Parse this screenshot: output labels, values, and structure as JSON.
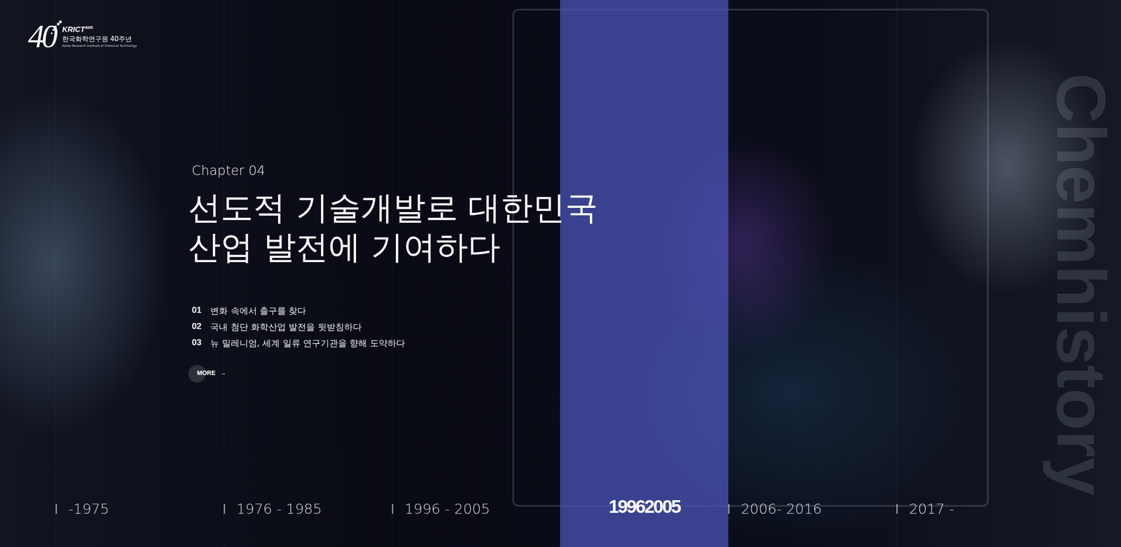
{
  "logo": {
    "mark": "40",
    "name": "KRICT",
    "superscript": "40th",
    "title": "한국화학연구원 40주년",
    "subtitle": "Korea Research Institute of Chemical Technology"
  },
  "chapter": {
    "label": "Chapter 04",
    "title_lines": [
      "선도적 기술개발로 대한민국",
      "산업 발전에 기여하다"
    ],
    "items": [
      {
        "number": "01",
        "text": "변화 속에서 출구를 찾다"
      },
      {
        "number": "02",
        "text": "국내 첨단 화학산업 발전을 뒷받침하다"
      },
      {
        "number": "03",
        "text": "뉴 밀레니엄, 세계 일류 연구기관을 향해 도약하다"
      }
    ],
    "more": {
      "label": "MORE",
      "arrow": "→"
    }
  },
  "watermark": "Chemhistory",
  "timeline": [
    {
      "label": "-1975",
      "selected": false
    },
    {
      "label": "1976 - 1985",
      "selected": false
    },
    {
      "label": "1996 - 2005",
      "selected": false
    },
    {
      "label": "19962005",
      "selected": true
    },
    {
      "label": "2006- 2016",
      "selected": false
    },
    {
      "label": "2017 -",
      "selected": false
    }
  ]
}
